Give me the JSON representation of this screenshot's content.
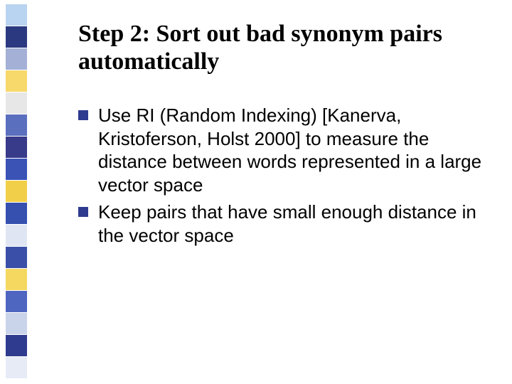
{
  "slide": {
    "title": "Step 2: Sort out bad synonym pairs automatically",
    "bullets": [
      "Use RI (Random Indexing) [Kanerva, Kristoferson, Holst 2000] to measure the distance between words represented in a large vector space",
      "Keep pairs that have small enough distance in the vector space"
    ]
  },
  "sidebar_colors": [
    "#b9d4f0",
    "#2b3a80",
    "#a4b0d6",
    "#f7d86a",
    "#e7e7e7",
    "#5b6fbf",
    "#383a8a",
    "#3a53b5",
    "#f2cf48",
    "#3650b0",
    "#dfe5f3",
    "#3a50a8",
    "#f4d85f",
    "#4f66c0",
    "#c9d3ea",
    "#2f3b8f",
    "#e6ebf6"
  ]
}
